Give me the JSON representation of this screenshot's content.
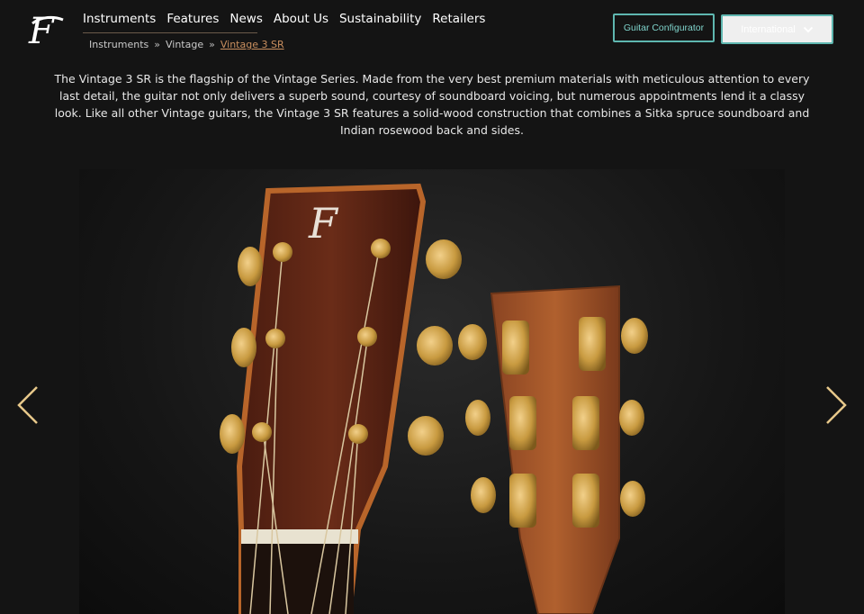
{
  "brand": {
    "logo_letter": "F"
  },
  "nav": {
    "items": [
      "Instruments",
      "Features",
      "News",
      "About Us",
      "Sustainability",
      "Retailers"
    ]
  },
  "breadcrumb": {
    "items": [
      "Instruments",
      "Vintage",
      "Vintage 3 SR"
    ],
    "separator": "»"
  },
  "header": {
    "configurator_label": "Guitar Configurator",
    "region_label": "International"
  },
  "description": "The Vintage 3 SR is the flagship of the Vintage Series. Made from the very best premium materials with meticulous attention to every last detail, the guitar not only delivers a superb sound, courtesy of soundboard voicing, but numerous appointments lend it a classy look. Like all other Vintage guitars, the Vintage 3 SR features a solid-wood construction that combines a Sitka spruce soundboard and Indian rosewood back and sides.",
  "gallery": {
    "prev_icon": "chevron-left-icon",
    "next_icon": "chevron-right-icon",
    "headstock_logo_letter": "F"
  },
  "colors": {
    "accent": "#5fb7b0",
    "breadcrumb_current": "#c98f5f",
    "background": "#141414"
  }
}
